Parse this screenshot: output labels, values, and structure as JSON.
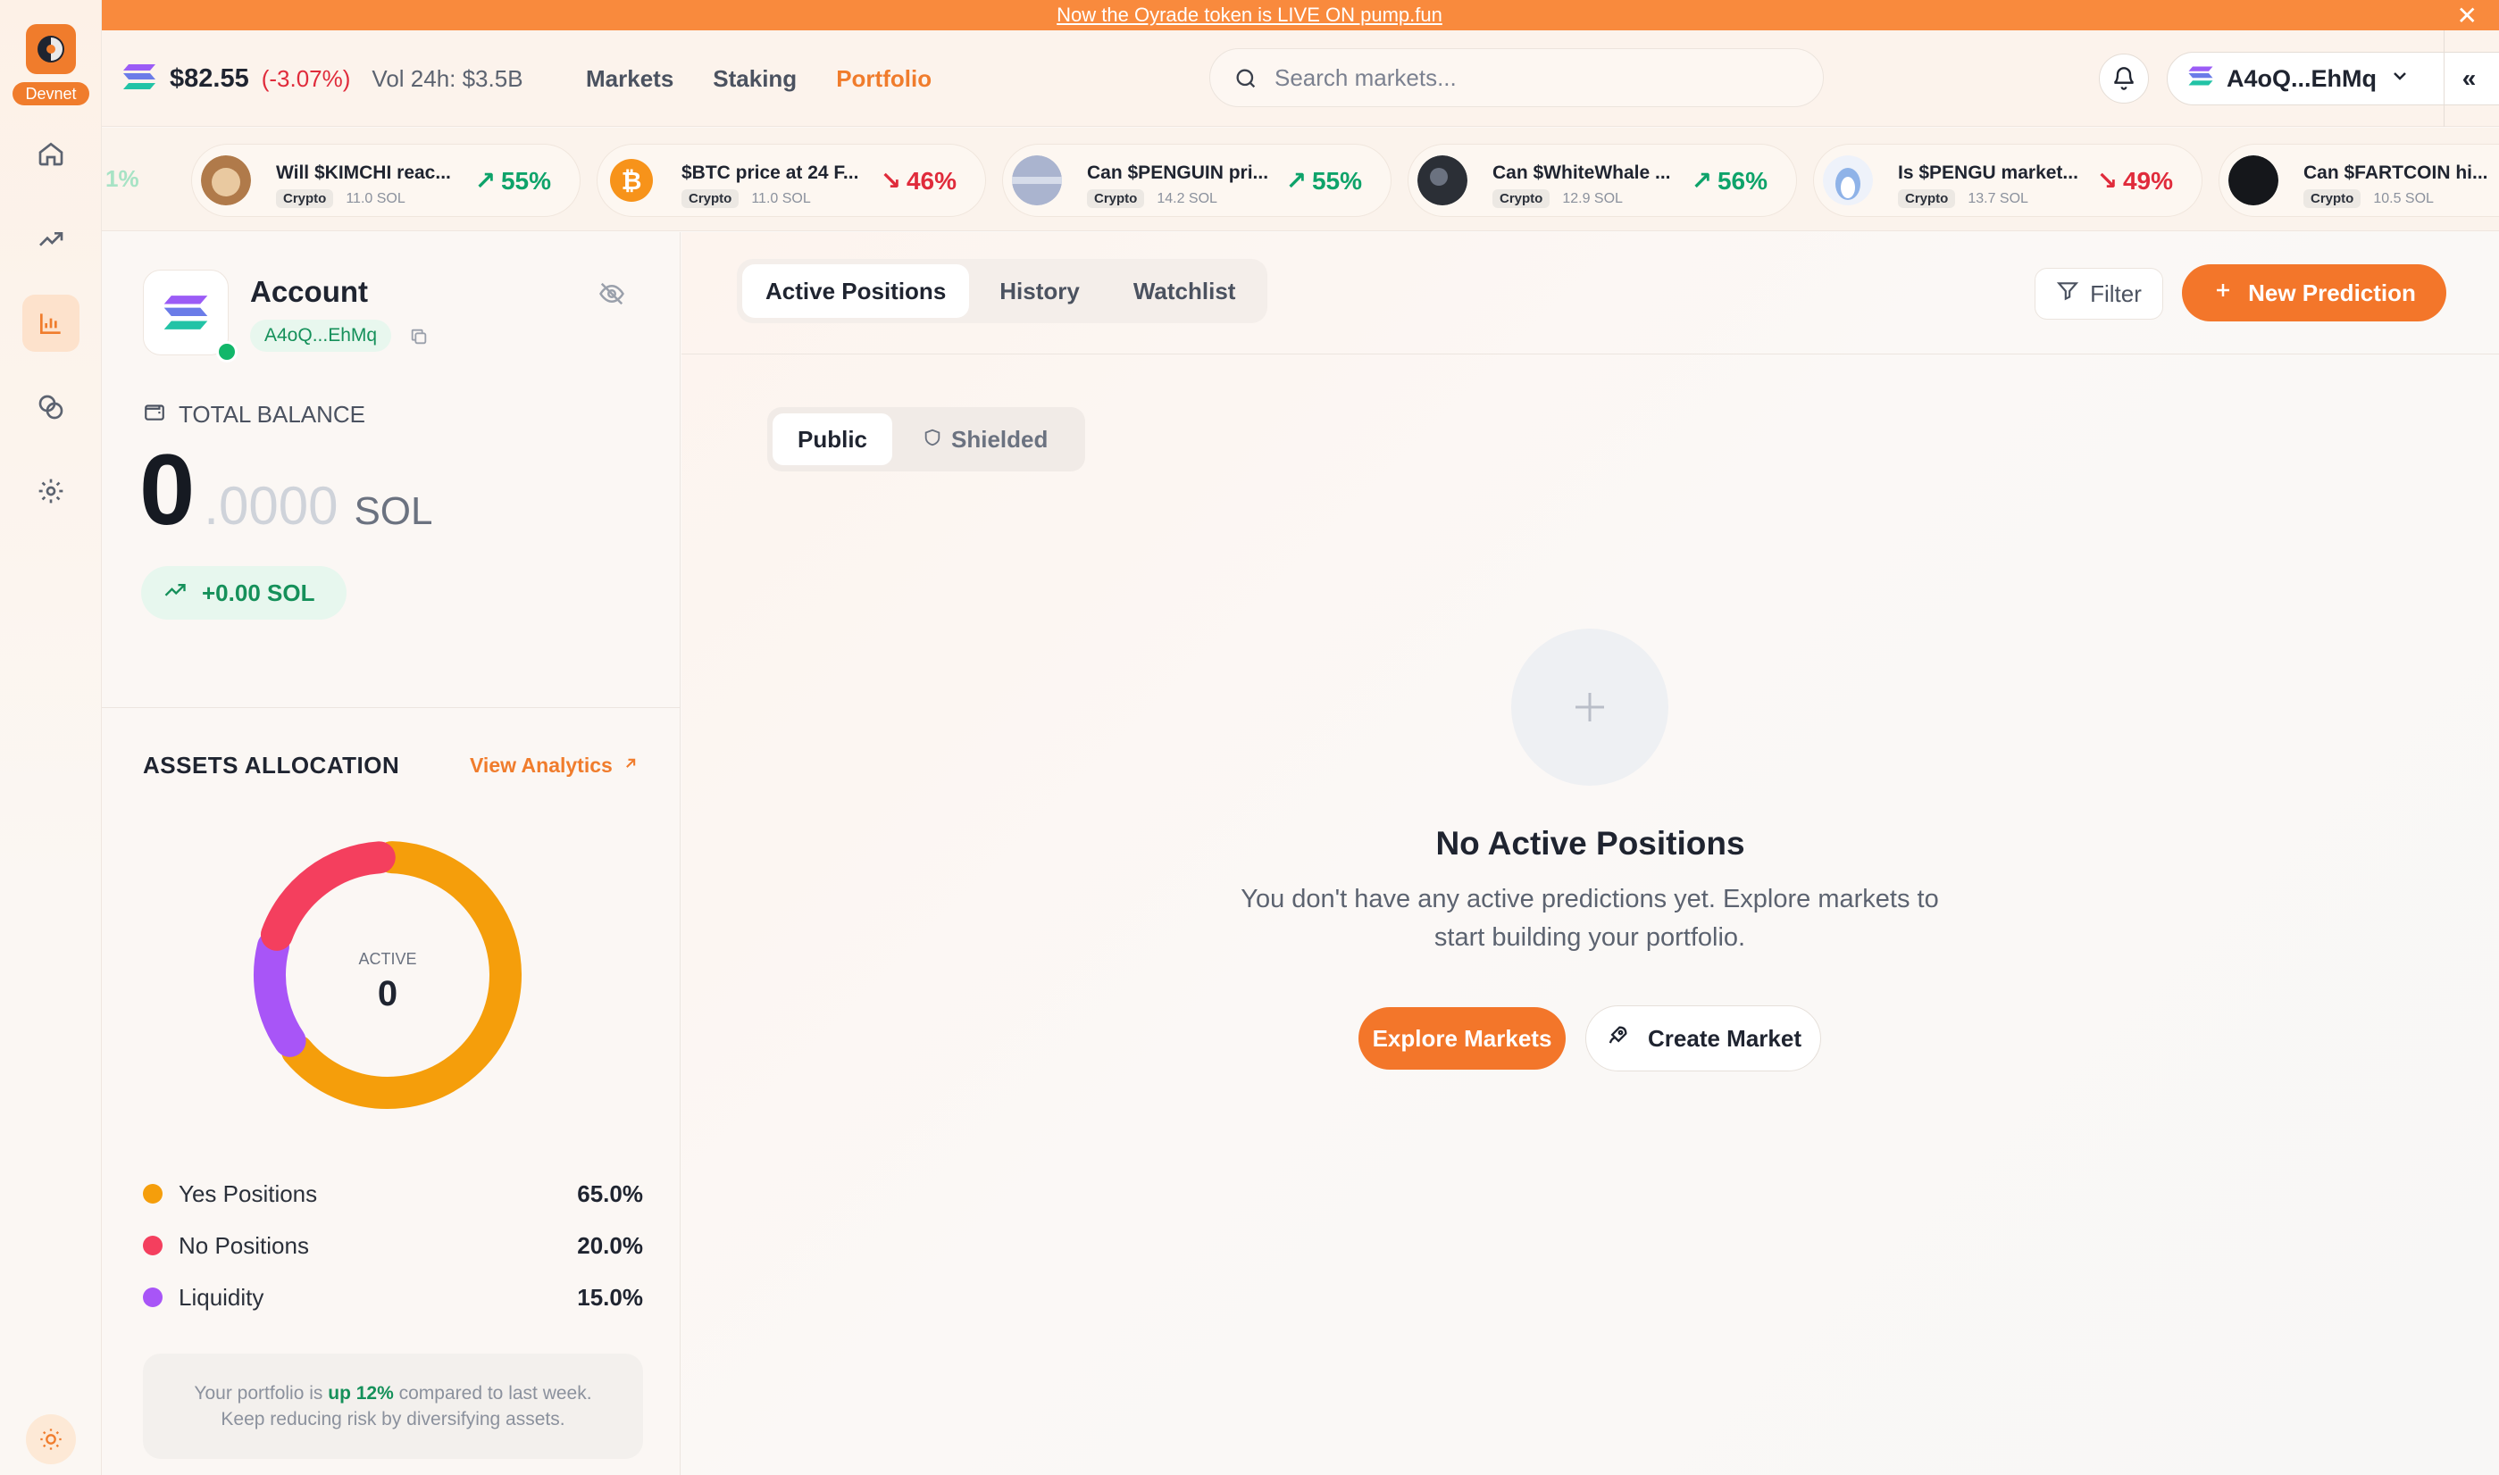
{
  "banner": {
    "text": "Now the Oyrade token is LIVE ON pump.fun",
    "close": "✕"
  },
  "rail": {
    "badge": "Devnet",
    "items": [
      {
        "icon": "home-icon"
      },
      {
        "icon": "trending-icon"
      },
      {
        "icon": "bar-chart-icon",
        "active": true
      },
      {
        "icon": "coins-icon"
      },
      {
        "icon": "gear-icon"
      }
    ],
    "theme_icon": "sun-icon"
  },
  "header": {
    "price": "$82.55",
    "change": "(-3.07%)",
    "volume": "Vol 24h: $3.5B",
    "nav": [
      "Markets",
      "Staking",
      "Portfolio"
    ],
    "active_nav": "Portfolio",
    "search_placeholder": "Search markets...",
    "wallet": "A4oQ...EhMq",
    "collapse": "«"
  },
  "ticker": {
    "fragment": "1%",
    "items": [
      {
        "question": "Will $KIMCHI reac...",
        "tag": "Crypto",
        "sol": "11.0 SOL",
        "pct": "55%",
        "dir": "up"
      },
      {
        "question": "$BTC price at 24 F...",
        "tag": "Crypto",
        "sol": "11.0 SOL",
        "pct": "46%",
        "dir": "down"
      },
      {
        "question": "Can $PENGUIN pri...",
        "tag": "Crypto",
        "sol": "14.2 SOL",
        "pct": "55%",
        "dir": "up"
      },
      {
        "question": "Can $WhiteWhale ...",
        "tag": "Crypto",
        "sol": "12.9 SOL",
        "pct": "56%",
        "dir": "up"
      },
      {
        "question": "Is $PENGU market...",
        "tag": "Crypto",
        "sol": "13.7 SOL",
        "pct": "49%",
        "dir": "down"
      },
      {
        "question": "Can $FARTCOIN hi...",
        "tag": "Crypto",
        "sol": "10.5 SOL",
        "pct": "",
        "dir": "up"
      }
    ]
  },
  "account": {
    "title": "Account",
    "address": "A4oQ...EhMq",
    "balance_label": "TOTAL BALANCE",
    "balance_int": "0",
    "balance_dec": ".0000",
    "balance_unit": "SOL",
    "gain": "+0.00 SOL"
  },
  "allocation": {
    "title": "ASSETS ALLOCATION",
    "link": "View Analytics",
    "center_label": "ACTIVE",
    "center_value": "0",
    "items": [
      {
        "name": "Yes Positions",
        "value": "65.0%",
        "pct": 65,
        "color": "#f59e0b"
      },
      {
        "name": "No Positions",
        "value": "20.0%",
        "pct": 20,
        "color": "#f43f5e"
      },
      {
        "name": "Liquidity",
        "value": "15.0%",
        "pct": 15,
        "color": "#a855f7"
      }
    ],
    "note_pre": "Your portfolio is",
    "note_highlight": "up 12%",
    "note_post": "compared to last week.",
    "note_line2": "Keep reducing risk by diversifying assets."
  },
  "main": {
    "tabs": [
      "Active Positions",
      "History",
      "Watchlist"
    ],
    "filter": "Filter",
    "new_prediction": "New Prediction",
    "segments": [
      "Public",
      "Shielded"
    ],
    "empty_title": "No Active Positions",
    "empty_text": "You don't have any active predictions yet. Explore markets to start building your portfolio.",
    "explore": "Explore Markets",
    "create": "Create Market"
  },
  "colors": {
    "accent": "#f07c2c",
    "up": "#0ea36a",
    "down": "#e02b3b"
  }
}
